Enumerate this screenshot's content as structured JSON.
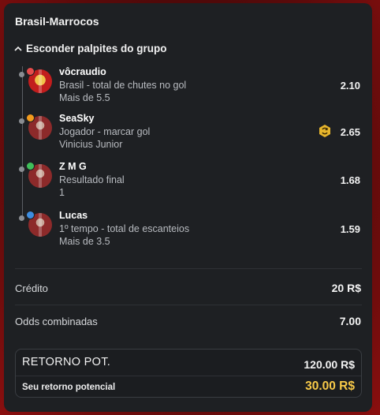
{
  "match_title": "Brasil-Marrocos",
  "group_toggle_label": "Esconder palpites do grupo",
  "bets": [
    {
      "user": "vôcraudio",
      "market": "Brasil - total de chutes no gol",
      "pick": "Mais de 5.5",
      "odds": "2.10",
      "badge_color": "#e54b4b",
      "boosted": false
    },
    {
      "user": "SeaSky",
      "market": "Jogador - marcar gol",
      "pick": "Vinicius Junior",
      "odds": "2.65",
      "badge_color": "#f29b1d",
      "boosted": true
    },
    {
      "user": "Z M G",
      "market": "Resultado final",
      "pick": "1",
      "odds": "1.68",
      "badge_color": "#3fbf5a",
      "boosted": false
    },
    {
      "user": "Lucas",
      "market": "1º tempo - total de escanteios",
      "pick": "Mais de 3.5",
      "odds": "1.59",
      "badge_color": "#3d8de0",
      "boosted": false
    }
  ],
  "credit": {
    "label": "Crédito",
    "value": "20 R$"
  },
  "combined_odds": {
    "label": "Odds combinadas",
    "value": "7.00"
  },
  "potential_return": {
    "label": "RETORNO POT.",
    "value": "120.00 R$"
  },
  "your_return": {
    "label": "Seu retorno potencial",
    "value": "30.00 R$"
  },
  "colors": {
    "accent": "#f7c948",
    "panel": "#1e2023",
    "background": "#7a0b0b"
  }
}
